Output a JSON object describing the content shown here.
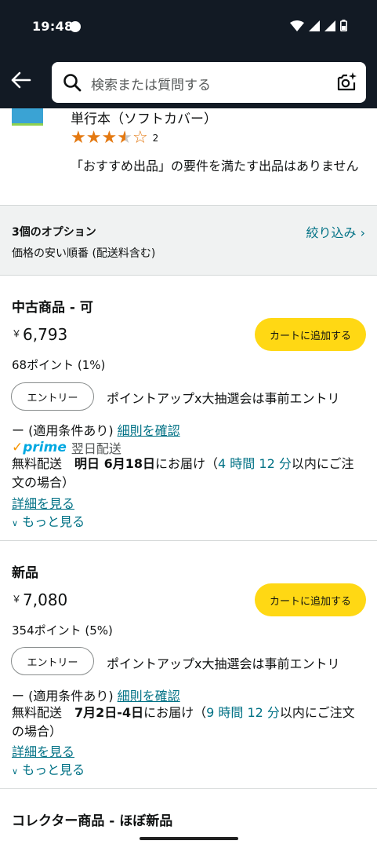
{
  "status_bar": {
    "time": "19:48"
  },
  "search": {
    "placeholder": "検索または質問する"
  },
  "product": {
    "format": "単行本（ソフトカバー）",
    "rating": 3.5,
    "review_count": "2",
    "recommend_note": "「おすすめ出品」の要件を満たす出品はありません"
  },
  "options": {
    "count": "3個のオプション",
    "sort": "価格の安い順番 (配送料含む)",
    "filter_label": "絞り込み ›"
  },
  "offers": [
    {
      "condition": "中古商品 - 可",
      "currency": "￥",
      "price": "6,793",
      "cart_label": "カートに追加する",
      "points": "68ポイント (1%)",
      "entry_label": "エントリー",
      "promo_line1": "ポイントアップx大抽選会は事前エントリ",
      "promo_line2": "ー (適用条件あり)",
      "promo_link": "細則を確認",
      "prime_label": "prime",
      "prime_shipping": "翌日配送",
      "delivery_prefix": "無料配送",
      "delivery_date": "明日 6月18日",
      "delivery_suffix": "にお届け（",
      "delivery_window": "4 時間 12 分",
      "delivery_end": "以内にご注文の場合）",
      "details_label": "詳細を見る",
      "more_label": "もっと見る"
    },
    {
      "condition": "新品",
      "currency": "￥",
      "price": "7,080",
      "cart_label": "カートに追加する",
      "points": "354ポイント (5%)",
      "entry_label": "エントリー",
      "promo_line1": "ポイントアップx大抽選会は事前エントリ",
      "promo_line2": "ー (適用条件あり)",
      "promo_link": "細則を確認",
      "delivery_prefix": "無料配送",
      "delivery_date": "7月2日-4日",
      "delivery_suffix": "にお届け（",
      "delivery_window": "9 時間 12 分",
      "delivery_end": "以内にご注文の場合）",
      "details_label": "詳細を見る",
      "more_label": "もっと見る"
    }
  ],
  "collector": {
    "condition": "コレクター商品 - ほぼ新品"
  },
  "colors": {
    "header_bg": "#121a24",
    "cart_button": "#ffd814",
    "link": "#007185",
    "star": "#e47911"
  },
  "icons": [
    "back-arrow-icon",
    "search-icon",
    "camera-sparkle-icon",
    "wifi-icon",
    "signal-icon",
    "battery-icon",
    "star-icon",
    "chevron-down-icon"
  ]
}
